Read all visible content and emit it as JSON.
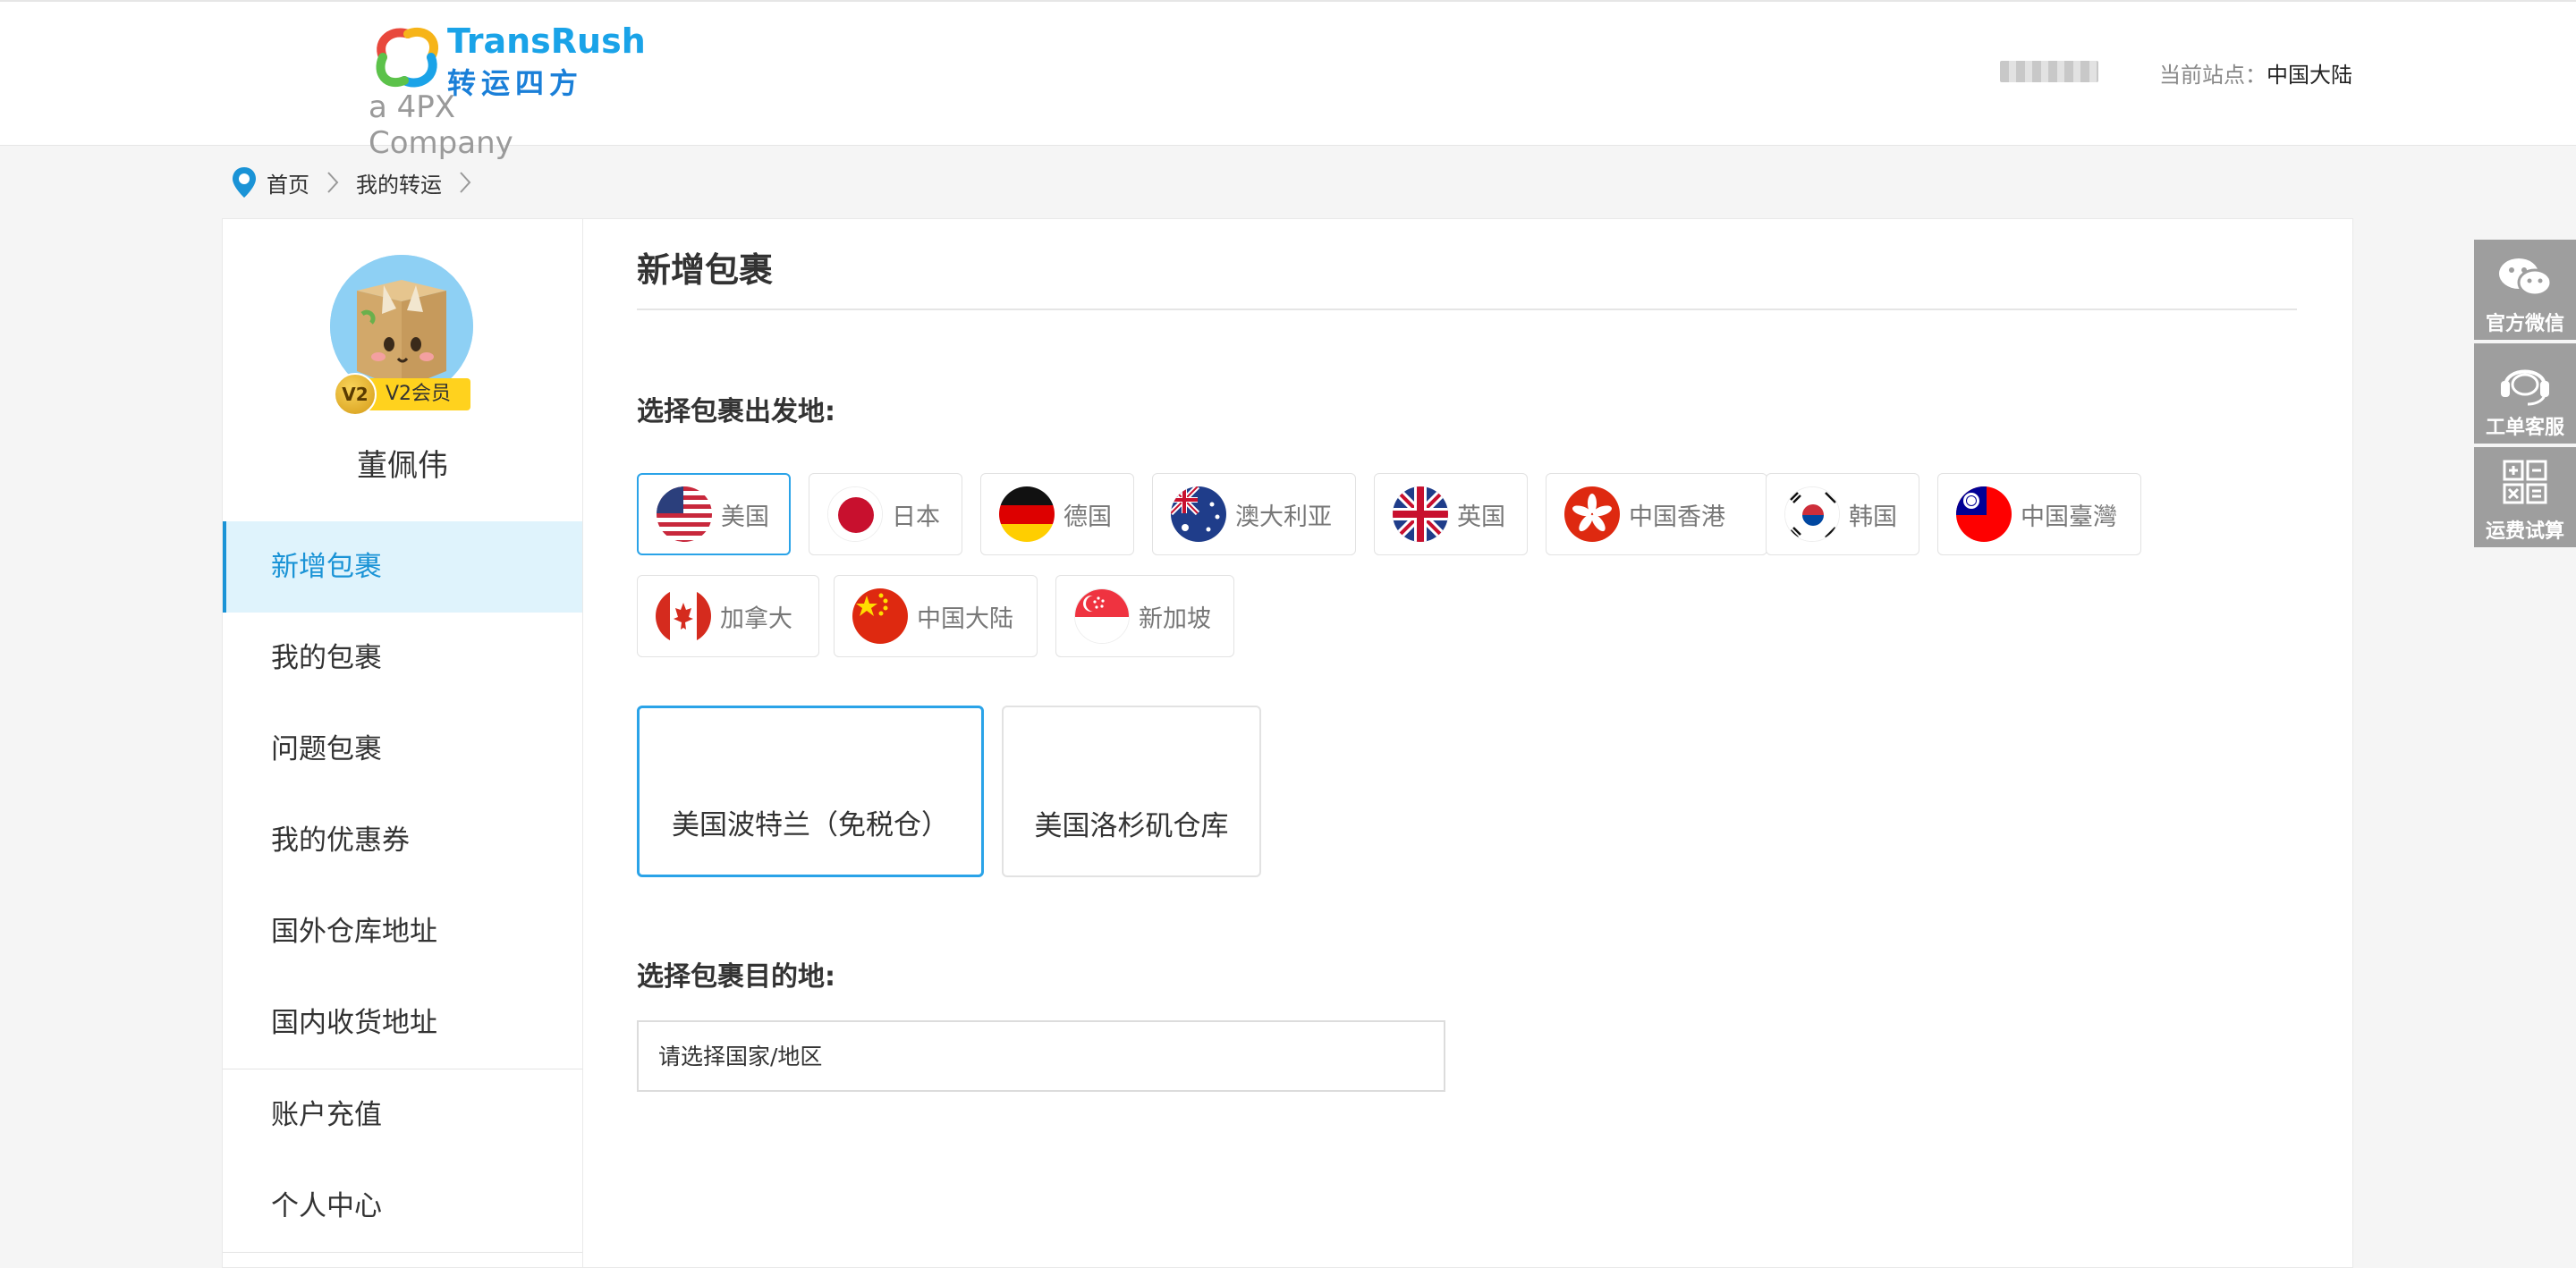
{
  "header": {
    "logo_brand": "TransRush",
    "logo_brand_cn": "转运四方",
    "logo_sub": "a 4PX Company",
    "station_label": "当前站点：",
    "station_value": "中国大陆"
  },
  "breadcrumb": [
    "首页",
    "我的转运"
  ],
  "sidebar": {
    "level_badge": "V2",
    "level_label": "V2会员",
    "username": "董佩伟",
    "menu": [
      {
        "label": "新增包裹",
        "active": true
      },
      {
        "label": "我的包裹"
      },
      {
        "label": "问题包裹"
      },
      {
        "label": "我的优惠券"
      },
      {
        "label": "国外仓库地址"
      },
      {
        "label": "国内收货地址"
      },
      {
        "label": "账户充值"
      },
      {
        "label": "个人中心"
      }
    ]
  },
  "main": {
    "title": "新增包裹",
    "origin_label": "选择包裹出发地:",
    "origins": [
      {
        "label": "美国",
        "flag": "us-flag",
        "selected": true
      },
      {
        "label": "日本",
        "flag": "jp-flag"
      },
      {
        "label": "德国",
        "flag": "de-flag"
      },
      {
        "label": "澳大利亚",
        "flag": "au-flag"
      },
      {
        "label": "英国",
        "flag": "gb-flag"
      },
      {
        "label": "中国香港",
        "flag": "hk-flag"
      },
      {
        "label": "韩国",
        "flag": "kr-flag"
      },
      {
        "label": "中国臺灣",
        "flag": "tw-flag"
      },
      {
        "label": "加拿大",
        "flag": "ca-flag"
      },
      {
        "label": "中国大陆",
        "flag": "cn-flag"
      },
      {
        "label": "新加坡",
        "flag": "sg-flag"
      }
    ],
    "warehouses": [
      {
        "label": "美国波特兰（免税仓）",
        "selected": true
      },
      {
        "label": "美国洛杉矶仓库"
      }
    ],
    "destination_label": "选择包裹目的地:",
    "destination_placeholder": "请选择国家/地区"
  },
  "float_tools": [
    {
      "label": "官方微信",
      "icon": "wechat-icon"
    },
    {
      "label": "工单客服",
      "icon": "headset-icon"
    },
    {
      "label": "运费试算",
      "icon": "calculator-icon"
    }
  ],
  "colors": {
    "accent": "#1a93d6",
    "active_bg": "#dff3fc",
    "tool_bg": "#9e9e9e"
  }
}
